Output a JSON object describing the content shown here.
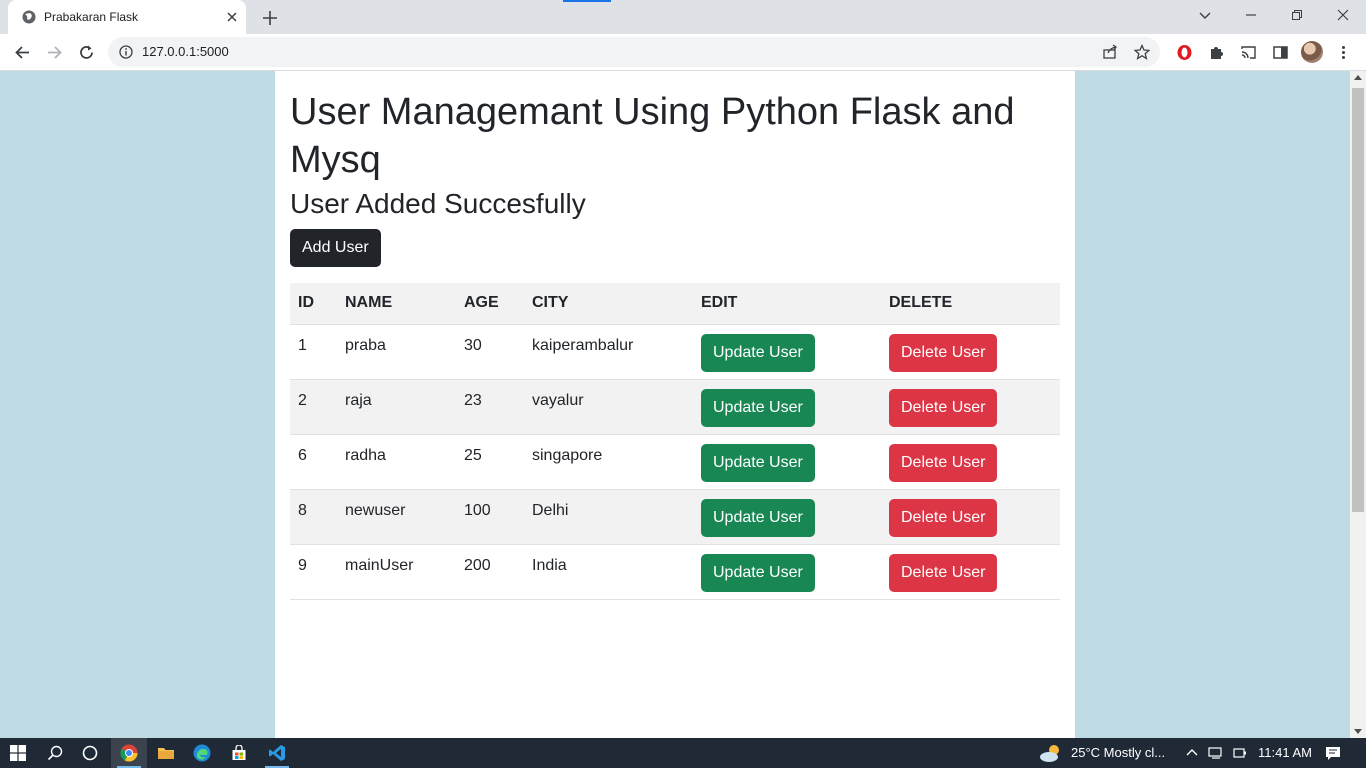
{
  "browser": {
    "tab_title": "Prabakaran Flask",
    "url": "127.0.0.1:5000"
  },
  "page": {
    "title": "User Managemant Using Python Flask and Mysq",
    "message": "User Added Succesfully",
    "add_button": "Add User",
    "columns": [
      "ID",
      "NAME",
      "AGE",
      "CITY",
      "EDIT",
      "DELETE"
    ],
    "rows": [
      {
        "id": "1",
        "name": "praba",
        "age": "30",
        "city": "kaiperambalur"
      },
      {
        "id": "2",
        "name": "raja",
        "age": "23",
        "city": "vayalur"
      },
      {
        "id": "6",
        "name": "radha",
        "age": "25",
        "city": "singapore"
      },
      {
        "id": "8",
        "name": "newuser",
        "age": "100",
        "city": "Delhi"
      },
      {
        "id": "9",
        "name": "mainUser",
        "age": "200",
        "city": "India"
      }
    ],
    "update_label": "Update User",
    "delete_label": "Delete User"
  },
  "taskbar": {
    "weather": "25°C  Mostly cl...",
    "time": "11:41 AM"
  },
  "colors": {
    "page_bg": "#bfdce4",
    "success": "#198754",
    "danger": "#dc3545",
    "dark": "#212529"
  }
}
